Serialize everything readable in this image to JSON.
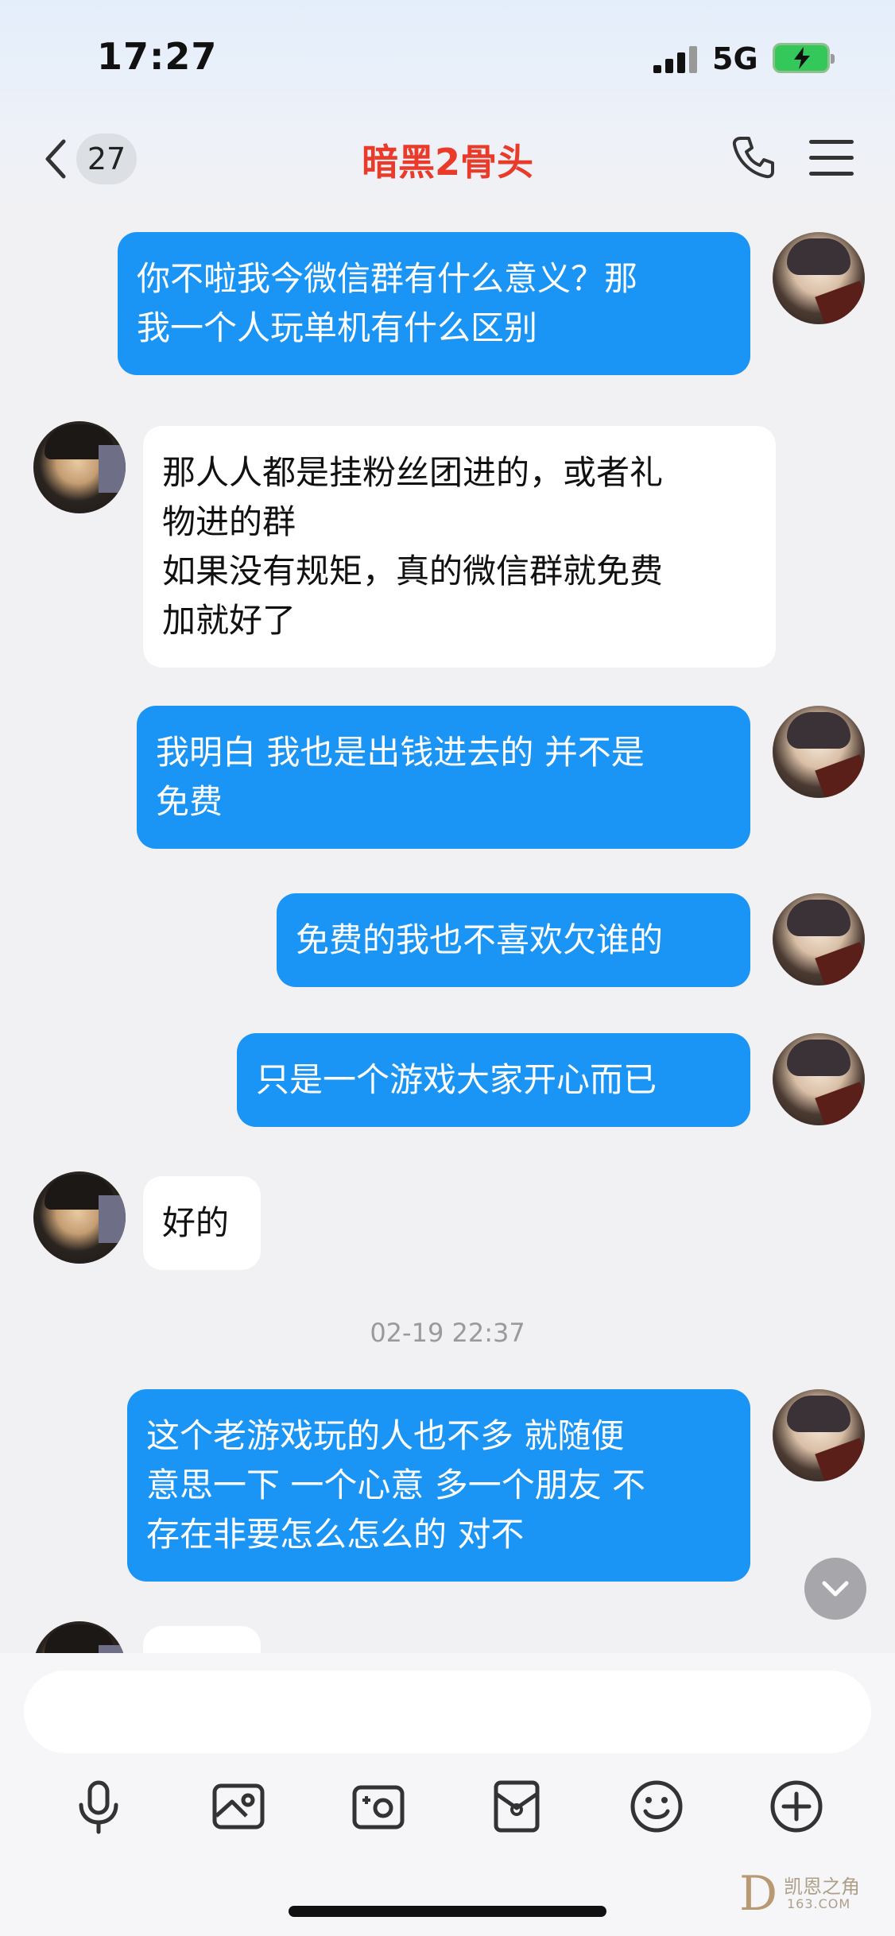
{
  "status_bar": {
    "time": "17:27",
    "network": "5G"
  },
  "nav": {
    "unread_count": "27",
    "title": "暗黑2骨头"
  },
  "messages": [
    {
      "side": "out",
      "text": "你不啦我今微信群有什么意义？那\n我一个人玩单机有什么区别"
    },
    {
      "side": "in",
      "text": "那人人都是挂粉丝团进的，或者礼\n物进的群\n如果没有规矩，真的微信群就免费\n加就好了"
    },
    {
      "side": "out",
      "text": "我明白 我也是出钱进去的 并不是\n免费"
    },
    {
      "side": "out",
      "text": "免费的我也不喜欢欠谁的"
    },
    {
      "side": "out",
      "text": "只是一个游戏大家开心而已"
    },
    {
      "side": "in",
      "text": "好的"
    },
    {
      "side": "out",
      "text": "这个老游戏玩的人也不多 就随便\n意思一下 一个心意 多一个朋友 不\n存在非要怎么怎么的 对不"
    }
  ],
  "timestamp": "02-19 22:37",
  "watermark": {
    "title": "凯恩之角",
    "site": "163.COM"
  },
  "icons": {
    "back": "chevron-left-icon",
    "call": "phone-icon",
    "menu": "menu-icon",
    "voice": "microphone-icon",
    "photo": "image-icon",
    "camera": "camera-icon",
    "red_packet": "red-packet-icon",
    "emoji": "emoji-icon",
    "more": "plus-icon",
    "scroll": "chevron-down-icon"
  },
  "colors": {
    "outgoing_bubble": "#1a94f5",
    "incoming_bubble": "#ffffff",
    "title": "#ea3a2a",
    "background": "#f1f1f4"
  }
}
